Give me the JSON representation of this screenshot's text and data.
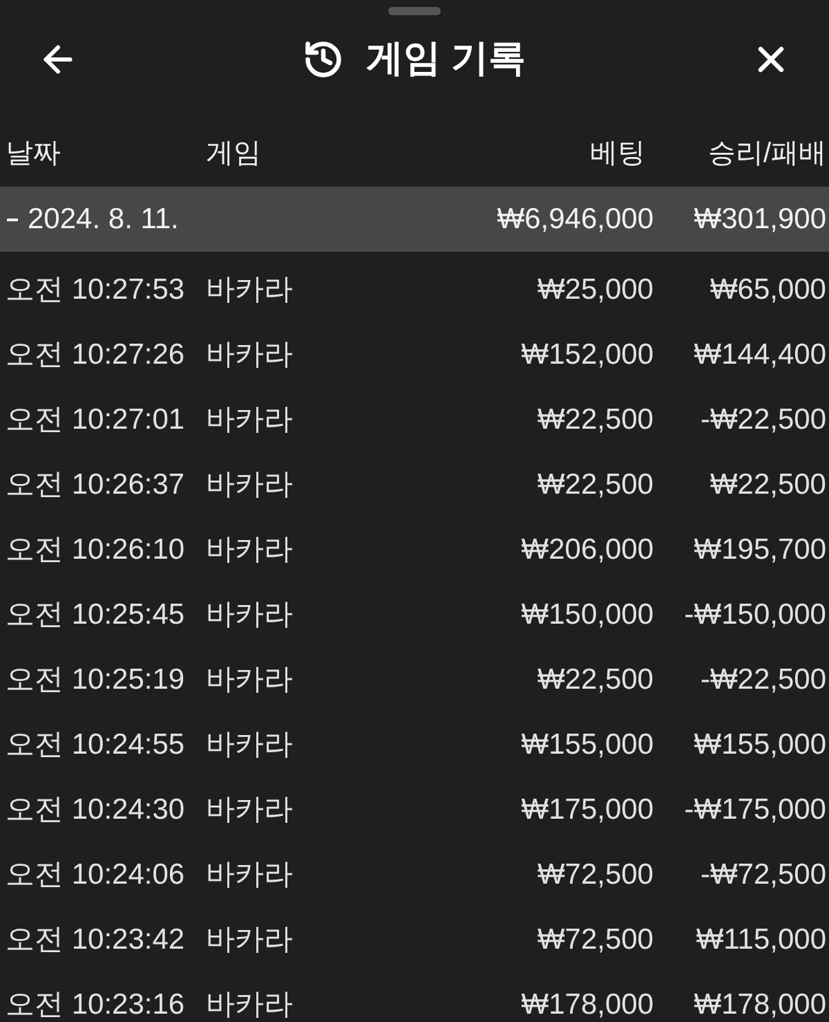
{
  "header": {
    "title": "게임 기록"
  },
  "columns": [
    "날짜",
    "게임",
    "베팅",
    "승리/패배"
  ],
  "groups": [
    {
      "date": "2024. 8. 11.",
      "expanded": true,
      "bet_total": "₩6,946,000",
      "result_total": "₩301,900",
      "rows": [
        {
          "time": "오전 10:27:53",
          "game": "바카라",
          "bet": "₩25,000",
          "result": "₩65,000"
        },
        {
          "time": "오전 10:27:26",
          "game": "바카라",
          "bet": "₩152,000",
          "result": "₩144,400"
        },
        {
          "time": "오전 10:27:01",
          "game": "바카라",
          "bet": "₩22,500",
          "result": "-₩22,500"
        },
        {
          "time": "오전 10:26:37",
          "game": "바카라",
          "bet": "₩22,500",
          "result": "₩22,500"
        },
        {
          "time": "오전 10:26:10",
          "game": "바카라",
          "bet": "₩206,000",
          "result": "₩195,700"
        },
        {
          "time": "오전 10:25:45",
          "game": "바카라",
          "bet": "₩150,000",
          "result": "-₩150,000"
        },
        {
          "time": "오전 10:25:19",
          "game": "바카라",
          "bet": "₩22,500",
          "result": "-₩22,500"
        },
        {
          "time": "오전 10:24:55",
          "game": "바카라",
          "bet": "₩155,000",
          "result": "₩155,000"
        },
        {
          "time": "오전 10:24:30",
          "game": "바카라",
          "bet": "₩175,000",
          "result": "-₩175,000"
        },
        {
          "time": "오전 10:24:06",
          "game": "바카라",
          "bet": "₩72,500",
          "result": "-₩72,500"
        },
        {
          "time": "오전 10:23:42",
          "game": "바카라",
          "bet": "₩72,500",
          "result": "₩115,000"
        },
        {
          "time": "오전 10:23:16",
          "game": "바카라",
          "bet": "₩178,000",
          "result": "₩178,000"
        }
      ]
    }
  ]
}
